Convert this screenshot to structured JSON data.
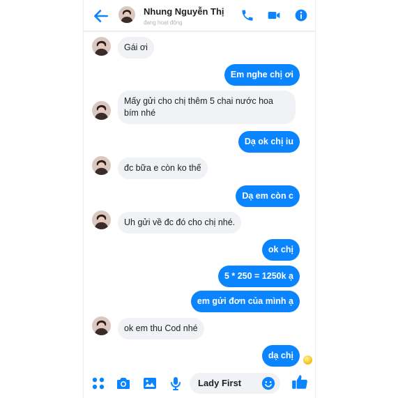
{
  "header": {
    "contact_name": "Nhung Nguyễn Thị",
    "status": "đang hoạt động"
  },
  "messages": [
    {
      "from": "them",
      "text": "Gái ơi"
    },
    {
      "from": "me",
      "text": "Em nghe chị ơi"
    },
    {
      "from": "them",
      "text": "Mấy gửi cho chị thêm 5 chai nước hoa bím nhé"
    },
    {
      "from": "me",
      "text": "Dạ ok chị iu"
    },
    {
      "from": "them",
      "text": "đc bữa e còn ko thế"
    },
    {
      "from": "me",
      "text": "Dạ em còn c"
    },
    {
      "from": "them",
      "text": "Uh gửi về đc đó cho chị nhé."
    },
    {
      "from": "me",
      "text": "ok chị"
    },
    {
      "from": "me",
      "text": "5 * 250 = 1250k ạ"
    },
    {
      "from": "me",
      "text": "em gửi đơn của mình ạ"
    },
    {
      "from": "them",
      "text": "ok em thu Cod nhé"
    },
    {
      "from": "me",
      "text": "dạ chị"
    }
  ],
  "composer": {
    "value": "Lady First"
  },
  "icons": {
    "back": "arrow-left-icon",
    "call": "phone-icon",
    "video": "video-camera-icon",
    "info": "info-icon",
    "more": "grid-dots-icon",
    "camera": "camera-icon",
    "gallery": "image-icon",
    "voice": "microphone-icon",
    "emoji": "smiley-icon",
    "like": "thumbs-up-icon"
  },
  "colors": {
    "accent": "#0b84ff",
    "incoming_bubble": "#f0f2f5",
    "seen_emoji": "#f5c518"
  }
}
